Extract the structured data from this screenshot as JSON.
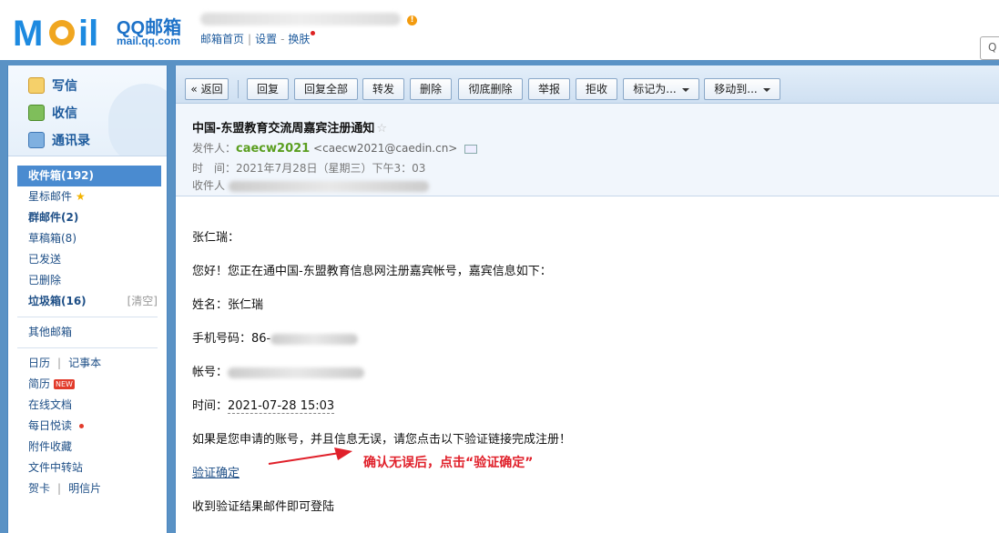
{
  "header": {
    "logo_text": "MOil",
    "brand": "QQ邮箱",
    "domain": "mail.qq.com",
    "nav": [
      "邮箱首页",
      "设置",
      "换肤"
    ],
    "separators": [
      "|",
      "-"
    ]
  },
  "sidebar": {
    "actions": [
      {
        "label": "写信",
        "icon": "pencil-paper-icon"
      },
      {
        "label": "收信",
        "icon": "download-arrow-icon"
      },
      {
        "label": "通讯录",
        "icon": "contact-card-icon"
      }
    ],
    "folders": {
      "inbox": "收件箱(192)",
      "starred": "星标邮件",
      "group": "群邮件(2)",
      "drafts": "草稿箱(8)",
      "sent": "已发送",
      "deleted": "已删除",
      "spam": "垃圾箱(16)",
      "spam_clear": "[清空]",
      "other": "其他邮箱",
      "calendar": "日历",
      "notes": "记事本",
      "resume": "简历",
      "resume_badge": "NEW",
      "docs": "在线文档",
      "daily": "每日悦读",
      "attachments": "附件收藏",
      "transfer": "文件中转站",
      "cards": "贺卡",
      "postcards": "明信片",
      "pipe": "|"
    }
  },
  "toolbar": {
    "back": "« 返回",
    "reply": "回复",
    "reply_all": "回复全部",
    "forward": "转发",
    "delete": "删除",
    "delete_perm": "彻底删除",
    "report": "举报",
    "reject": "拒收",
    "mark_as": "标记为...",
    "move_to": "移动到..."
  },
  "mail": {
    "subject": "中国-东盟教育交流周嘉宾注册通知",
    "star": "☆",
    "from_label": "发件人：",
    "from_name": "caecw2021",
    "from_addr": "<caecw2021@caedin.cn>",
    "time_label": "时　间：",
    "time_value": "2021年7月28日（星期三）下午3：03",
    "to_label": "收件人"
  },
  "body": {
    "greeting": "张仁瑞：",
    "intro": "您好！您正在通中国-东盟教育信息网注册嘉宾帐号，嘉宾信息如下：",
    "name": "姓名：张仁瑞",
    "phone": "手机号码：86-",
    "account": "帐号：",
    "time_label": "时间：",
    "time_value": "2021-07-28 15:03",
    "instruction": "如果是您申请的账号，并且信息无误，请您点击以下验证链接完成注册！",
    "link": "验证确定",
    "footer": "收到验证结果邮件即可登陆"
  },
  "annotation": "确认无误后，点击“验证确定”",
  "colors": {
    "brand_blue": "#1d72c8",
    "frame_blue": "#5a92c5",
    "sender_green": "#5a9e1f",
    "annotation_red": "#e0202a"
  }
}
